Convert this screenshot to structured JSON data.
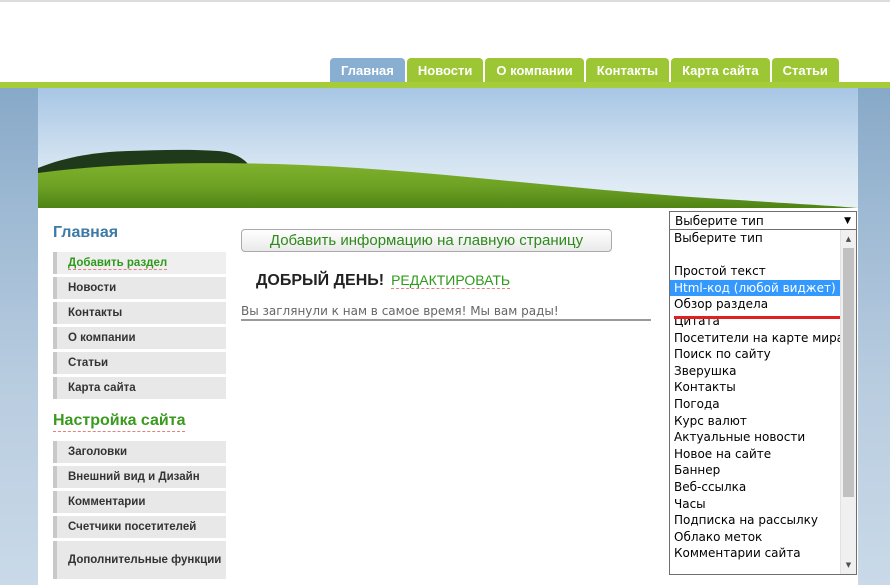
{
  "nav": {
    "tabs": [
      {
        "label": "Главная",
        "active": true
      },
      {
        "label": "Новости"
      },
      {
        "label": "О компании"
      },
      {
        "label": "Контакты"
      },
      {
        "label": "Карта сайта"
      },
      {
        "label": "Статьи"
      }
    ]
  },
  "sidebar": {
    "main_title": "Главная",
    "main_items": [
      {
        "label": "Добавить раздел"
      },
      {
        "label": "Новости"
      },
      {
        "label": "Контакты"
      },
      {
        "label": "О компании"
      },
      {
        "label": "Статьи"
      },
      {
        "label": "Карта сайта"
      }
    ],
    "settings_title": "Настройка сайта",
    "settings_items": [
      {
        "label": "Заголовки"
      },
      {
        "label": "Внешний вид и Дизайн"
      },
      {
        "label": "Комментарии"
      },
      {
        "label": "Счетчики посетителей"
      },
      {
        "label": "Дополнительные функции"
      }
    ]
  },
  "main": {
    "add_info_button": "Добавить информацию на главную страницу",
    "greeting": "ДОБРЫЙ ДЕНЬ!",
    "edit_link": "РЕДАКТИРОВАТЬ",
    "welcome_text": "Вы заглянули к нам в самое время! Мы вам рады!"
  },
  "type_select": {
    "value": "Выберите тип",
    "options": [
      "Выберите тип",
      "",
      "Простой текст",
      "Html-код (любой виджет)",
      "Обзор раздела",
      "Цитата",
      "Посетители на карте мира",
      "Поиск по сайту",
      "Зверушка",
      "Контакты",
      "Погода",
      "Курс валют",
      "Актуальные новости",
      "Новое на сайте",
      "Баннер",
      "Веб-ссылка",
      "Часы",
      "Подписка на рассылку",
      "Облако меток",
      "Комментарии сайта"
    ],
    "highlighted_option": "Html-код (любой виджет)"
  },
  "colors": {
    "nav_tab": "#9dc634",
    "nav_tab_active": "#88aed1",
    "green_text": "#2e9a1b",
    "blue_title": "#3d7aa5",
    "selection": "#3399ff",
    "annotation_red": "#e02020"
  }
}
